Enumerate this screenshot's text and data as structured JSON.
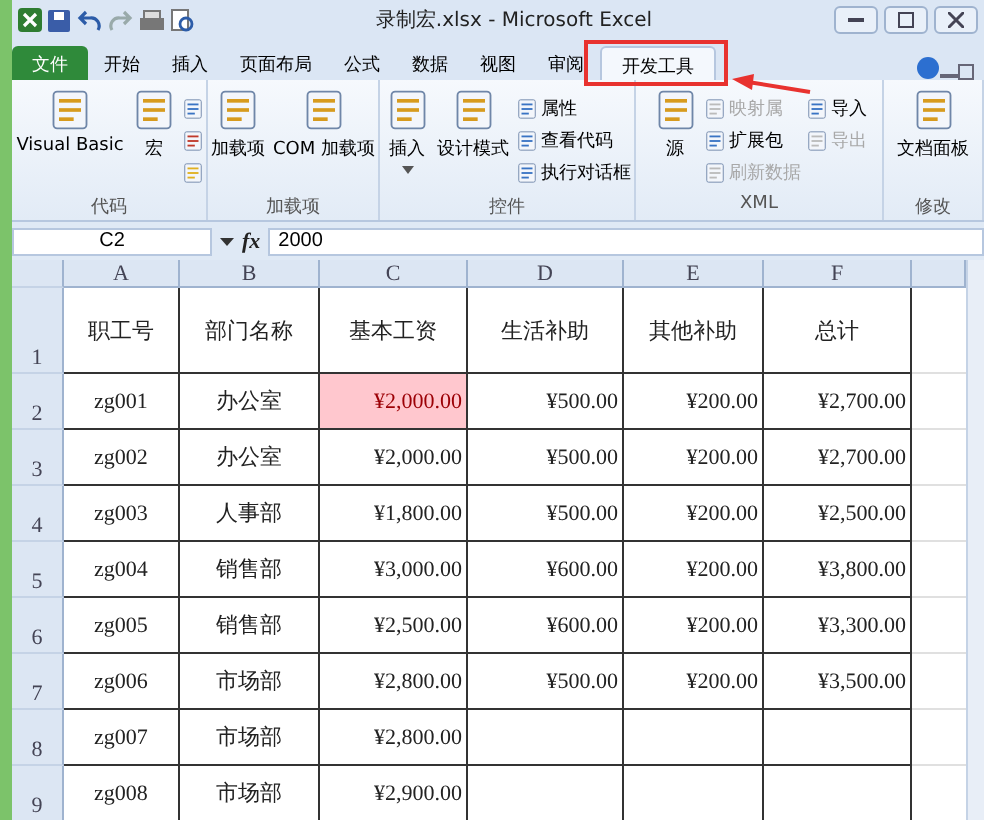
{
  "window": {
    "title": "录制宏.xlsx - Microsoft Excel"
  },
  "tabs": [
    {
      "label": "文件",
      "kind": "file",
      "selected": false
    },
    {
      "label": "开始",
      "kind": "tab",
      "selected": false
    },
    {
      "label": "插入",
      "kind": "tab",
      "selected": false
    },
    {
      "label": "页面布局",
      "kind": "tab",
      "selected": false
    },
    {
      "label": "公式",
      "kind": "tab",
      "selected": false
    },
    {
      "label": "数据",
      "kind": "tab",
      "selected": false
    },
    {
      "label": "视图",
      "kind": "tab",
      "selected": false
    },
    {
      "label": "审阅",
      "kind": "tab",
      "selected": false
    },
    {
      "label": "开发工具",
      "kind": "tab",
      "selected": true
    }
  ],
  "annotations": {
    "highlight_selected_tab": true,
    "arrow": true
  },
  "ribbon_groups": [
    {
      "label": "代码",
      "items": [
        {
          "kind": "large",
          "label": "Visual Basic"
        },
        {
          "kind": "large",
          "label": "宏"
        },
        {
          "kind": "icons"
        }
      ]
    },
    {
      "label": "加载项",
      "items": [
        {
          "kind": "large",
          "label": "加载项"
        },
        {
          "kind": "large",
          "label": "COM 加载项"
        }
      ]
    },
    {
      "label": "控件",
      "items": [
        {
          "kind": "large",
          "label": "插入",
          "dropdown": true
        },
        {
          "kind": "large",
          "label": "设计模式"
        },
        {
          "kind": "smalls",
          "entries": [
            {
              "label": "属性",
              "disabled": false
            },
            {
              "label": "查看代码",
              "disabled": false
            },
            {
              "label": "执行对话框",
              "disabled": false
            }
          ]
        }
      ]
    },
    {
      "label": "XML",
      "items": [
        {
          "kind": "large",
          "label": "源"
        },
        {
          "kind": "smalls",
          "entries": [
            {
              "label": "映射属",
              "disabled": true
            },
            {
              "label": "扩展包",
              "disabled": false
            },
            {
              "label": "刷新数据",
              "disabled": true
            }
          ]
        },
        {
          "kind": "smalls",
          "entries": [
            {
              "label": "导入",
              "disabled": false
            },
            {
              "label": "导出",
              "disabled": true
            }
          ]
        }
      ]
    },
    {
      "label": "修改",
      "items": [
        {
          "kind": "large",
          "label": "文档面板"
        }
      ]
    }
  ],
  "formula_bar": {
    "name_box": "C2",
    "function_label": "fx",
    "formula": "2000"
  },
  "columns": [
    "A",
    "B",
    "C",
    "D",
    "E",
    "F"
  ],
  "rows": [
    {
      "number": "1",
      "kind": "header",
      "cells": [
        {
          "text": "职工号",
          "highlighted": false
        },
        {
          "text": "部门名称",
          "highlighted": false
        },
        {
          "text": "基本工资",
          "highlighted": false
        },
        {
          "text": "生活补助",
          "highlighted": false
        },
        {
          "text": "其他补助",
          "highlighted": false
        },
        {
          "text": "总计",
          "highlighted": false
        }
      ]
    },
    {
      "number": "2",
      "kind": "data",
      "cells": [
        {
          "text": "zg001",
          "highlighted": false
        },
        {
          "text": "办公室",
          "highlighted": false
        },
        {
          "text": "¥2,000.00",
          "highlighted": true
        },
        {
          "text": "¥500.00",
          "highlighted": false
        },
        {
          "text": "¥200.00",
          "highlighted": false
        },
        {
          "text": "¥2,700.00",
          "highlighted": false
        }
      ]
    },
    {
      "number": "3",
      "kind": "data",
      "cells": [
        {
          "text": "zg002",
          "highlighted": false
        },
        {
          "text": "办公室",
          "highlighted": false
        },
        {
          "text": "¥2,000.00",
          "highlighted": false
        },
        {
          "text": "¥500.00",
          "highlighted": false
        },
        {
          "text": "¥200.00",
          "highlighted": false
        },
        {
          "text": "¥2,700.00",
          "highlighted": false
        }
      ]
    },
    {
      "number": "4",
      "kind": "data",
      "cells": [
        {
          "text": "zg003",
          "highlighted": false
        },
        {
          "text": "人事部",
          "highlighted": false
        },
        {
          "text": "¥1,800.00",
          "highlighted": false
        },
        {
          "text": "¥500.00",
          "highlighted": false
        },
        {
          "text": "¥200.00",
          "highlighted": false
        },
        {
          "text": "¥2,500.00",
          "highlighted": false
        }
      ]
    },
    {
      "number": "5",
      "kind": "data",
      "cells": [
        {
          "text": "zg004",
          "highlighted": false
        },
        {
          "text": "销售部",
          "highlighted": false
        },
        {
          "text": "¥3,000.00",
          "highlighted": false
        },
        {
          "text": "¥600.00",
          "highlighted": false
        },
        {
          "text": "¥200.00",
          "highlighted": false
        },
        {
          "text": "¥3,800.00",
          "highlighted": false
        }
      ]
    },
    {
      "number": "6",
      "kind": "data",
      "cells": [
        {
          "text": "zg005",
          "highlighted": false
        },
        {
          "text": "销售部",
          "highlighted": false
        },
        {
          "text": "¥2,500.00",
          "highlighted": false
        },
        {
          "text": "¥600.00",
          "highlighted": false
        },
        {
          "text": "¥200.00",
          "highlighted": false
        },
        {
          "text": "¥3,300.00",
          "highlighted": false
        }
      ]
    },
    {
      "number": "7",
      "kind": "data",
      "cells": [
        {
          "text": "zg006",
          "highlighted": false
        },
        {
          "text": "市场部",
          "highlighted": false
        },
        {
          "text": "¥2,800.00",
          "highlighted": false
        },
        {
          "text": "¥500.00",
          "highlighted": false
        },
        {
          "text": "¥200.00",
          "highlighted": false
        },
        {
          "text": "¥3,500.00",
          "highlighted": false
        }
      ]
    },
    {
      "number": "8",
      "kind": "data",
      "cells": [
        {
          "text": "zg007",
          "highlighted": false
        },
        {
          "text": "市场部",
          "highlighted": false
        },
        {
          "text": "¥2,800.00",
          "highlighted": false
        }
      ]
    },
    {
      "number": "9",
      "kind": "data",
      "cells": [
        {
          "text": "zg008",
          "highlighted": false
        },
        {
          "text": "市场部",
          "highlighted": false
        },
        {
          "text": "¥2,900.00",
          "highlighted": false
        }
      ]
    }
  ]
}
